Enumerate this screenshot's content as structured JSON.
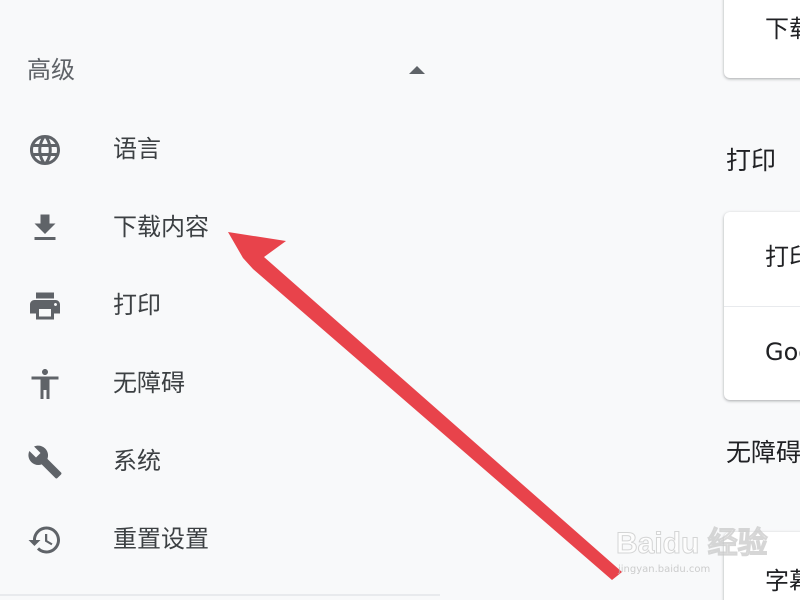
{
  "sidebar": {
    "section_title": "高级",
    "items": [
      {
        "label": "语言",
        "icon": "globe-icon"
      },
      {
        "label": "下载内容",
        "icon": "download-icon"
      },
      {
        "label": "打印",
        "icon": "printer-icon"
      },
      {
        "label": "无障碍",
        "icon": "accessibility-icon"
      },
      {
        "label": "系统",
        "icon": "wrench-icon"
      },
      {
        "label": "重置设置",
        "icon": "history-icon"
      }
    ]
  },
  "content": {
    "download_card_row": "下载",
    "print_heading": "打印",
    "print_rows": [
      "打印",
      "Goo"
    ],
    "accessibility_heading": "无障碍",
    "accessibility_row": "字幕"
  },
  "annotation": {
    "arrow_color": "#e8434b",
    "points_to": "下载内容"
  },
  "watermark": {
    "brand": "Baidu 经验",
    "url": "jingyan.baidu.com"
  },
  "colors": {
    "background": "#f8f9fa",
    "icon": "#5f6368",
    "text": "#3c4043"
  }
}
